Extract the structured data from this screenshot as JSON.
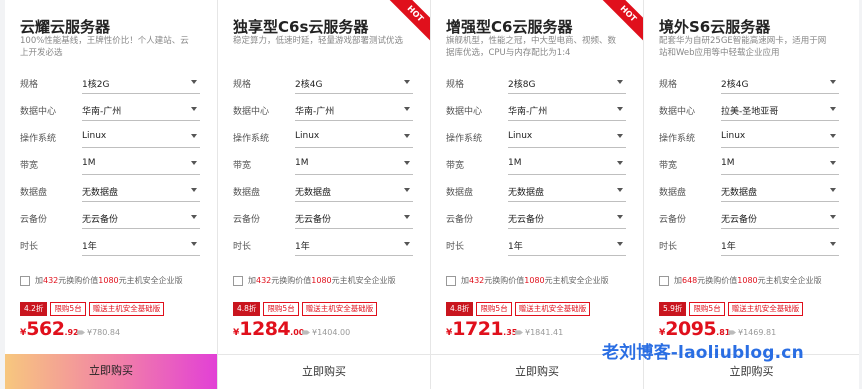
{
  "cards": [
    {
      "title": "云耀云服务器",
      "desc": "100%性能基线，王牌性价比！个人建站、云上开发必选",
      "hot": "",
      "options": [
        {
          "label": "规格",
          "value": "1核2G"
        },
        {
          "label": "数据中心",
          "value": "华南-广州"
        },
        {
          "label": "操作系统",
          "value": "Linux"
        },
        {
          "label": "带宽",
          "value": "1M"
        },
        {
          "label": "数据盘",
          "value": "无数据盘"
        },
        {
          "label": "云备份",
          "value": "无云备份"
        },
        {
          "label": "时长",
          "value": "1年"
        }
      ],
      "addon": {
        "pre": "加",
        "price": "432",
        "mid": "元换购价值",
        "worth": "1080",
        "post": "元主机安全企业版"
      },
      "discount": "4.2折",
      "tag1": "限购5台",
      "tag2": "赠送主机安全基础版",
      "price_cur": "¥",
      "price_int": "562",
      "price_dec": ".92",
      "orig_price": "¥780.84",
      "buy": "立即购买"
    },
    {
      "title": "独享型C6s云服务器",
      "desc": "稳定算力，低速时延，轻量游戏部署测试优选",
      "hot": "HOT",
      "options": [
        {
          "label": "规格",
          "value": "2核4G"
        },
        {
          "label": "数据中心",
          "value": "华南-广州"
        },
        {
          "label": "操作系统",
          "value": "Linux"
        },
        {
          "label": "带宽",
          "value": "1M"
        },
        {
          "label": "数据盘",
          "value": "无数据盘"
        },
        {
          "label": "云备份",
          "value": "无云备份"
        },
        {
          "label": "时长",
          "value": "1年"
        }
      ],
      "addon": {
        "pre": "加",
        "price": "432",
        "mid": "元换购价值",
        "worth": "1080",
        "post": "元主机安全企业版"
      },
      "discount": "4.8折",
      "tag1": "限购5台",
      "tag2": "赠送主机安全基础版",
      "price_cur": "¥",
      "price_int": "1284",
      "price_dec": ".00",
      "orig_price": "¥1404.00",
      "buy": "立即购买"
    },
    {
      "title": "增强型C6云服务器",
      "desc": "旗舰机型，性能之冠，中大型电商、视频、数据库优选，CPU与内存配比为1:4",
      "hot": "HOT",
      "options": [
        {
          "label": "规格",
          "value": "2核8G"
        },
        {
          "label": "数据中心",
          "value": "华南-广州"
        },
        {
          "label": "操作系统",
          "value": "Linux"
        },
        {
          "label": "带宽",
          "value": "1M"
        },
        {
          "label": "数据盘",
          "value": "无数据盘"
        },
        {
          "label": "云备份",
          "value": "无云备份"
        },
        {
          "label": "时长",
          "value": "1年"
        }
      ],
      "addon": {
        "pre": "加",
        "price": "432",
        "mid": "元换购价值",
        "worth": "1080",
        "post": "元主机安全企业版"
      },
      "discount": "4.8折",
      "tag1": "限购5台",
      "tag2": "赠送主机安全基础版",
      "price_cur": "¥",
      "price_int": "1721",
      "price_dec": ".35",
      "orig_price": "¥1841.41",
      "buy": "立即购买"
    },
    {
      "title": "境外S6云服务器",
      "desc": "配套华为自研25GE智能高速网卡，适用于网站和Web应用等中轻载企业应用",
      "hot": "",
      "options": [
        {
          "label": "规格",
          "value": "2核4G"
        },
        {
          "label": "数据中心",
          "value": "拉美-圣地亚哥"
        },
        {
          "label": "操作系统",
          "value": "Linux"
        },
        {
          "label": "带宽",
          "value": "1M"
        },
        {
          "label": "数据盘",
          "value": "无数据盘"
        },
        {
          "label": "云备份",
          "value": "无云备份"
        },
        {
          "label": "时长",
          "value": "1年"
        }
      ],
      "addon": {
        "pre": "加",
        "price": "648",
        "mid": "元换购价值",
        "worth": "1080",
        "post": "元主机安全企业版"
      },
      "discount": "5.9折",
      "tag1": "限购5台",
      "tag2": "赠送主机安全基础版",
      "price_cur": "¥",
      "price_int": "2095",
      "price_dec": ".81",
      "orig_price": "¥1469.81",
      "buy": "立即购买"
    }
  ],
  "watermark": "老刘博客-laoliublog.cn"
}
